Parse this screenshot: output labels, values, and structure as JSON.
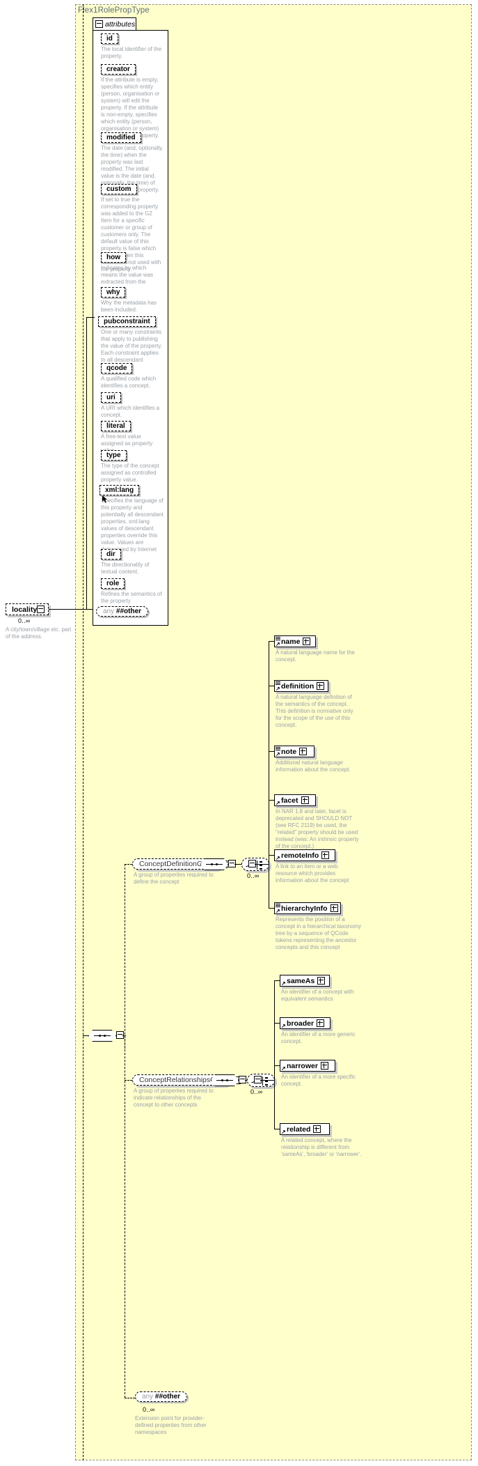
{
  "diagram": {
    "type_name": "Flex1RolePropType",
    "attributes_tab": {
      "label": "attributes",
      "toggle": "minus-icon"
    }
  },
  "attributes": [
    {
      "name": "id",
      "desc": "The local identifier of the property."
    },
    {
      "name": "creator",
      "desc": "If the attribute is empty, specifies which entity (person, organisation or system) will edit the property. If the attribute is non-empty, specifies which entity (person, organisation or system) has edited the property."
    },
    {
      "name": "modified",
      "desc": "The date (and, optionally, the time) when the property was last modified. The initial value is the date (and, optionally, the time) of creation of the property."
    },
    {
      "name": "custom",
      "desc": "If set to true the corresponding property was added to the G2 Item for a specific customer or group of customers only. The default value of this property is false which applies when this attribute is not used with the property."
    },
    {
      "name": "how",
      "desc": "Indicates by which means the value was extracted from the content."
    },
    {
      "name": "why",
      "desc": "Why the metadata has been included."
    },
    {
      "name": "pubconstraint",
      "desc": "One or many constraints that apply to publishing the value of the property. Each constraint applies to all descendant elements."
    },
    {
      "name": "qcode",
      "desc": "A qualified code which identifies a concept."
    },
    {
      "name": "uri",
      "desc": "A URI which identifies a concept."
    },
    {
      "name": "literal",
      "desc": "A free-text value assigned as property value."
    },
    {
      "name": "type",
      "desc": "The type of the concept assigned as controlled property value."
    },
    {
      "name": "xml:lang",
      "desc": "Specifies the language of this property and potentially all descendant properties. xml:lang values of descendant properties override this value. Values are determined by Internet BCP 47."
    },
    {
      "name": "dir",
      "desc": "The directionality of textual content."
    },
    {
      "name": "role",
      "desc": "Refines the semantics of the property"
    }
  ],
  "attributes_any": {
    "any": "any",
    "other": "##other"
  },
  "locality": {
    "name": "locality",
    "cardinality": "0..∞",
    "desc": "A city/town/village etc. part of the address.",
    "toggle": "minus-icon"
  },
  "concept_definition_group": {
    "name": "ConceptDefinitionGroup",
    "desc": "A group of properites required to define the concept",
    "cardinality": "0..∞",
    "children": [
      {
        "name": "name",
        "desc": "A natural language name for the concept.",
        "has_seq_icon": true
      },
      {
        "name": "definition",
        "desc": "A natural language definition of the semantics of the concept. This definition is normative only for the scope of the use of this concept.",
        "has_seq_icon": true
      },
      {
        "name": "note",
        "desc": "Additional natural language information about the concept.",
        "has_seq_icon": true
      },
      {
        "name": "facet",
        "desc": "In NAR 1.8 and later, facet is deprecated and SHOULD NOT (see RFC 2119) be used, the \"related\" property should be used instead (was: An intrinsic property of the concept.)",
        "has_seq_icon": false
      },
      {
        "name": "remoteInfo",
        "desc": "A link to an item or a web resource which provides information about the concept",
        "has_seq_icon": false
      },
      {
        "name": "hierarchyInfo",
        "desc": "Represents the position of a concept in a hierarchical taxonomy tree by a sequence of QCode tokens representing the ancestor concepts and this concept",
        "has_seq_icon": true
      }
    ]
  },
  "concept_relationships_group": {
    "name": "ConceptRelationshipsGroup",
    "desc": "A group of properties required to indicate relationships of the concept to other concepts",
    "cardinality": "0..∞",
    "children": [
      {
        "name": "sameAs",
        "desc": "An identifier of a concept with equivalent semantics",
        "has_seq_icon": false
      },
      {
        "name": "broader",
        "desc": "An identifier of a more generic concept.",
        "has_seq_icon": false
      },
      {
        "name": "narrower",
        "desc": "An identifier of a more specific concept.",
        "has_seq_icon": false
      },
      {
        "name": "related",
        "desc": "A related concept, where the relationship is different from 'sameAs', 'broader' or 'narrower'.",
        "has_seq_icon": false
      }
    ]
  },
  "extension_any": {
    "any": "any",
    "other": "##other",
    "cardinality": "0..∞",
    "desc": "Extension point for provider-defined properties from other namespaces"
  },
  "colors": {
    "type_bg": "#ffffcc",
    "type_border": "#8a8a8a",
    "title_text": "#5a6b7b",
    "desc_text": "#9aa0a6",
    "box_shadow": "#c9c9c9"
  }
}
